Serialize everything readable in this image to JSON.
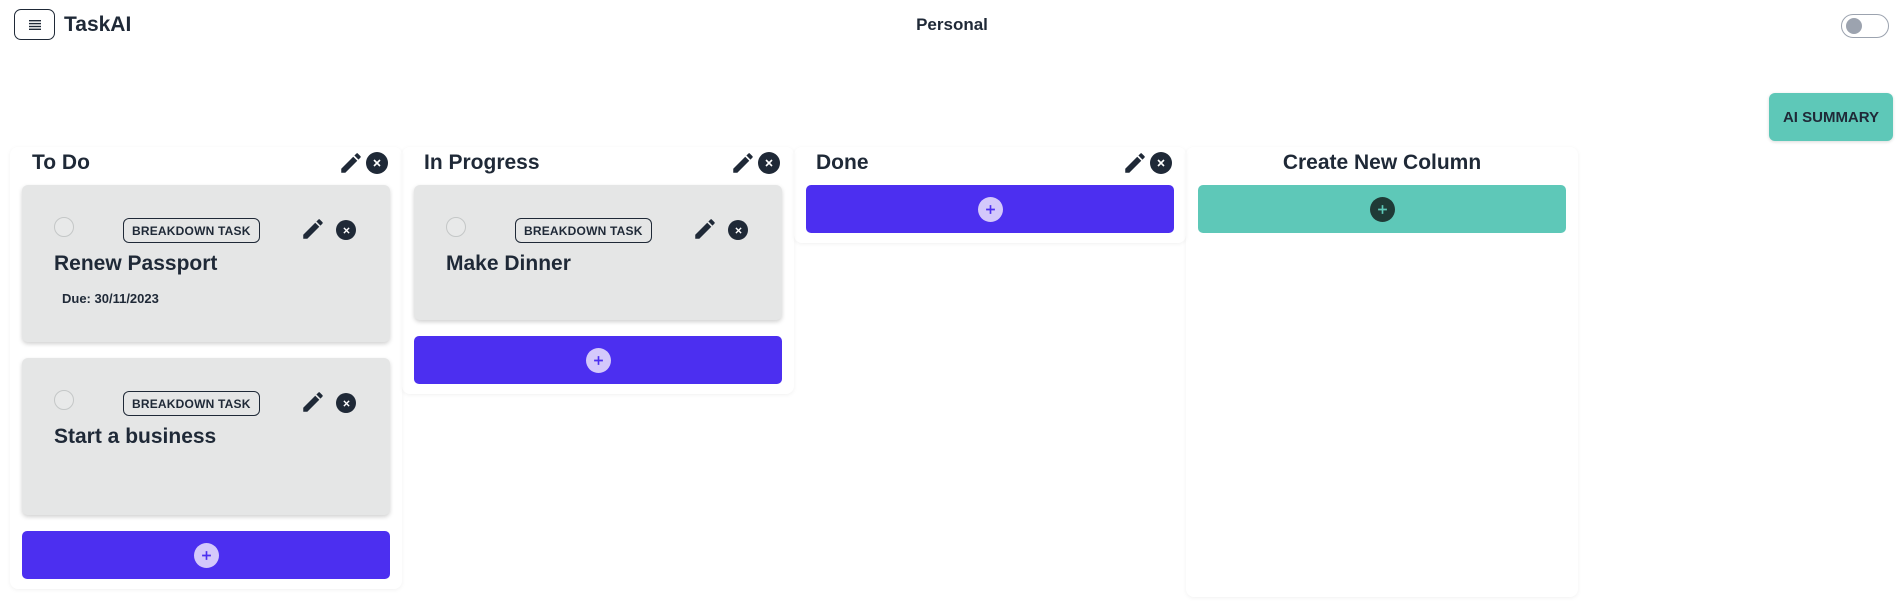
{
  "header": {
    "app_title": "TaskAI",
    "workspace": "Personal",
    "menu_icon": "hamburger-icon",
    "theme_toggle": "off"
  },
  "ai_summary_label": "AI SUMMARY",
  "columns": [
    {
      "title": "To Do",
      "tasks": [
        {
          "title": "Renew Passport",
          "tag": "BREAKDOWN TASK",
          "due": "Due: 30/11/2023"
        },
        {
          "title": "Start a business",
          "tag": "BREAKDOWN TASK",
          "due": ""
        }
      ]
    },
    {
      "title": "In Progress",
      "tasks": [
        {
          "title": "Make Dinner",
          "tag": "BREAKDOWN TASK",
          "due": ""
        }
      ]
    },
    {
      "title": "Done",
      "tasks": []
    }
  ],
  "create_column": {
    "title": "Create New Column"
  },
  "colors": {
    "primary": "#4c2ff0",
    "accent": "#5ec8b8",
    "card": "#e5e6e6",
    "text": "#1f2937"
  },
  "icons": {
    "edit": "pencil-icon",
    "delete": "close-circle-icon",
    "add": "plus-circle-icon"
  }
}
